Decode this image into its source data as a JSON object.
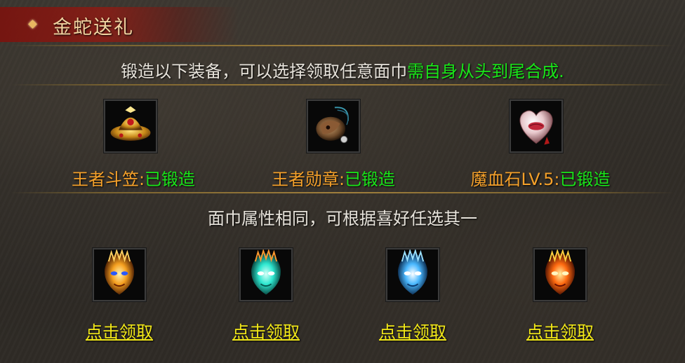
{
  "title": "金蛇送礼",
  "intro": {
    "text": "锻造以下装备，可以选择领取任意面巾",
    "highlight": "需自身从头到尾合成."
  },
  "equipment": [
    {
      "name": "王者斗笠:",
      "status": "已锻造",
      "icon": "golden-hat-icon"
    },
    {
      "name": "王者勋章:",
      "status": "已锻造",
      "icon": "medal-icon"
    },
    {
      "name": "魔血石LV.5:",
      "status": "已锻造",
      "icon": "blood-stone-heart-icon"
    }
  ],
  "mask_note": "面巾属性相同，可根据喜好任选其一",
  "masks": [
    {
      "icon": "fire-mask-icon",
      "claim_label": "点击领取",
      "color": "#f5a020"
    },
    {
      "icon": "cyan-mask-icon",
      "claim_label": "点击领取",
      "color": "#2ee8d0"
    },
    {
      "icon": "ice-mask-icon",
      "claim_label": "点击领取",
      "color": "#4ab8ff"
    },
    {
      "icon": "flame-mask-icon",
      "claim_label": "点击领取",
      "color": "#ff6a10"
    }
  ],
  "colors": {
    "highlight_green": "#19e619",
    "equip_name": "#f4a02a",
    "claim_link": "#f2e818",
    "title_bar": "#8c1c14"
  }
}
